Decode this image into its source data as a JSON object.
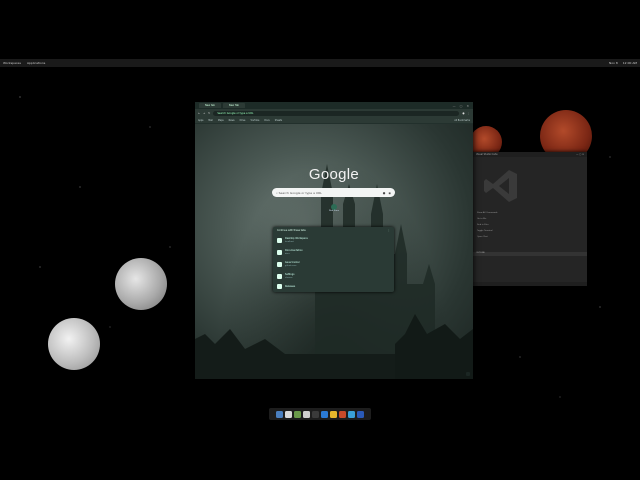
{
  "topbar": {
    "left_items": [
      "Workspaces",
      "Applications"
    ],
    "right_items": [
      "Nov 8",
      "12:00 AM"
    ]
  },
  "browser": {
    "tabs": [
      "New tab",
      "New Tab"
    ],
    "omnibox_placeholder": "Search Google or type a URL",
    "bookmarks": [
      "Apps",
      "Mail",
      "Maps",
      "News",
      "Drive",
      "YouTube",
      "Docs",
      "Sheets",
      "All Bookmarks"
    ],
    "google_logo": "Google",
    "search_placeholder": "Search Google or type a URL",
    "shortcut_label": "Web Store",
    "panel": {
      "title": "Continue with these tabs",
      "items": [
        {
          "title": "Desktop Workspace",
          "sub": "localhost"
        },
        {
          "title": "Documentation",
          "sub": "docs"
        },
        {
          "title": "Issue tracker",
          "sub": "github.com"
        },
        {
          "title": "Settings",
          "sub": "chrome"
        },
        {
          "title": "Releases",
          "sub": "changelog"
        }
      ]
    }
  },
  "code_window": {
    "title": "Visual Studio Code",
    "rows": [
      "Show All Commands",
      "Go to File",
      "Find in Files",
      "Toggle Terminal",
      "Open Chat"
    ],
    "panel_label": "OUTLINE"
  },
  "colors": {
    "accent": "#2c6c55",
    "browser_frame": "#2c3a35"
  }
}
